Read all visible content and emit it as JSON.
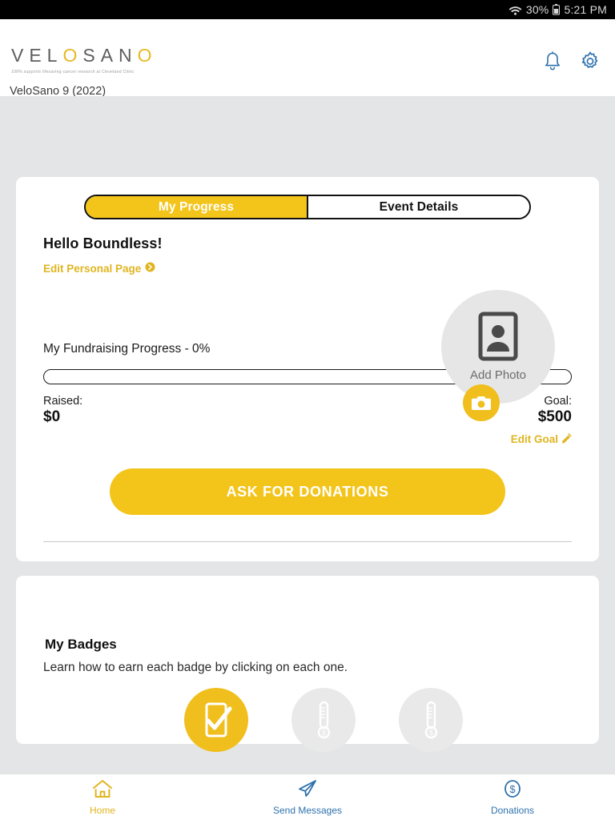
{
  "status_bar": {
    "wifi_icon": "wifi-icon",
    "battery_percent": "30%",
    "battery_icon": "battery-icon",
    "time": "5:21 PM"
  },
  "header": {
    "logo_text": "VELOSANO",
    "logo_highlight_indices": [
      3,
      7
    ],
    "logo_tagline": "100% supports lifesaving cancer research at Cleveland Clinic",
    "event_name": "VeloSano 9 (2022)",
    "notifications_icon": "bell-icon",
    "settings_icon": "gear-icon"
  },
  "tabs": [
    {
      "label": "My Progress",
      "active": true
    },
    {
      "label": "Event Details",
      "active": false
    }
  ],
  "progress_card": {
    "greeting": "Hello Boundless!",
    "edit_personal_page": "Edit Personal Page",
    "edit_personal_icon": "circle-arrow-right-icon",
    "photo": {
      "label": "Add Photo",
      "placeholder_icon": "contact-card-icon",
      "camera_badge_icon": "camera-icon"
    },
    "fundraising_title": "My Fundraising Progress - 0%",
    "progress_percent": 0,
    "raised_label": "Raised:",
    "raised_value": "$0",
    "goal_label": "Goal:",
    "goal_value": "$500",
    "edit_goal": "Edit Goal",
    "edit_goal_icon": "pencil-icon",
    "ask_button": "ASK FOR DONATIONS"
  },
  "badges_card": {
    "title": "My Badges",
    "subtitle": "Learn how to earn each badge by clicking on each one.",
    "badges": [
      {
        "name": "badge-self-donation",
        "icon": "phone-check-icon",
        "earned": true
      },
      {
        "name": "badge-thermometer-1",
        "icon": "thermometer-dollar-icon",
        "earned": false
      },
      {
        "name": "badge-thermometer-2",
        "icon": "thermometer-dollar-icon",
        "earned": false
      }
    ]
  },
  "bottom_nav": [
    {
      "label": "Home",
      "icon": "home-icon",
      "active": true
    },
    {
      "label": "Send Messages",
      "icon": "paper-plane-icon",
      "active": false
    },
    {
      "label": "Donations",
      "icon": "dollar-circle-icon",
      "active": false
    }
  ],
  "colors": {
    "brand_yellow": "#f3c41a",
    "brand_yellow_dark": "#e0b520",
    "nav_blue": "#2f72ad",
    "page_background": "#e4e5e6",
    "card_background": "#ffffff"
  }
}
